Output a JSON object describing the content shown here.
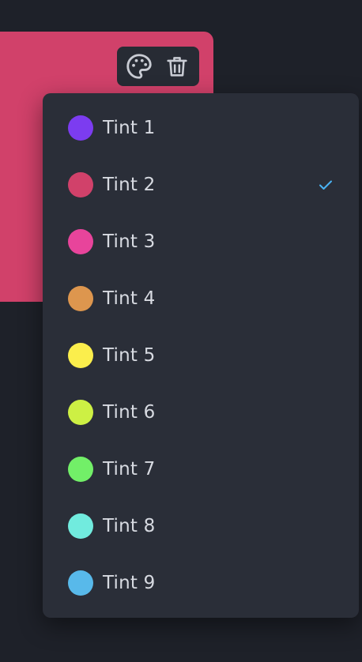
{
  "colors": {
    "background": "#1e2129",
    "card": "#d1416a",
    "toolbar": "#272b34",
    "menu": "#2a2e38",
    "label": "#d7dae1",
    "check": "#4ab3f4",
    "icon": "#c9ccd4"
  },
  "toolbar": {
    "palette_icon": "palette-icon",
    "delete_icon": "trash-icon"
  },
  "menu": {
    "selected_index": 1,
    "items": [
      {
        "label": "Tint 1",
        "color": "#7c3cf0"
      },
      {
        "label": "Tint 2",
        "color": "#d1416a"
      },
      {
        "label": "Tint 3",
        "color": "#e8449b"
      },
      {
        "label": "Tint 4",
        "color": "#dd964e"
      },
      {
        "label": "Tint 5",
        "color": "#fbee4c"
      },
      {
        "label": "Tint 6",
        "color": "#cdf044"
      },
      {
        "label": "Tint 7",
        "color": "#72ef68"
      },
      {
        "label": "Tint 8",
        "color": "#71ebde"
      },
      {
        "label": "Tint 9",
        "color": "#58b9ea"
      }
    ]
  }
}
